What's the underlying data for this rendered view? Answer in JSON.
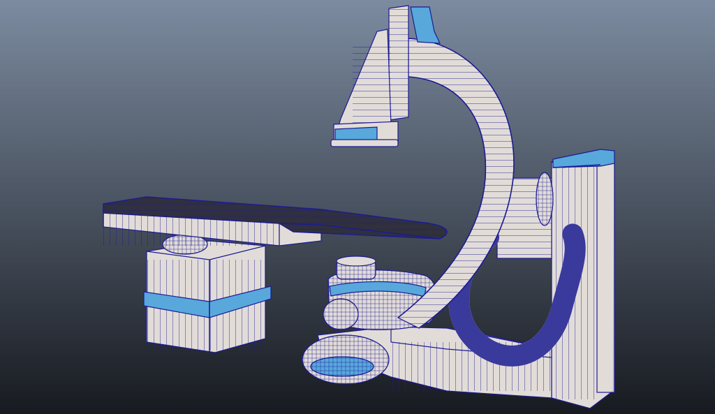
{
  "viewport": {
    "background_top": "#7c8ba0",
    "background_bottom": "#171a20"
  },
  "model": {
    "surface_color": "#e2dcd8",
    "accent_color": "#58a8dc",
    "wire_color": "#1c1c92",
    "tabletop_color": "#30303e",
    "parts": [
      {
        "name": "patient-table",
        "label": ""
      },
      {
        "name": "table-pedestal",
        "label": ""
      },
      {
        "name": "c-arm",
        "label": ""
      },
      {
        "name": "xray-detector",
        "label": ""
      },
      {
        "name": "xray-tube-housing",
        "label": ""
      },
      {
        "name": "c-arm-support-column",
        "label": ""
      },
      {
        "name": "floor-base",
        "label": ""
      },
      {
        "name": "cable-hose",
        "label": ""
      }
    ]
  }
}
